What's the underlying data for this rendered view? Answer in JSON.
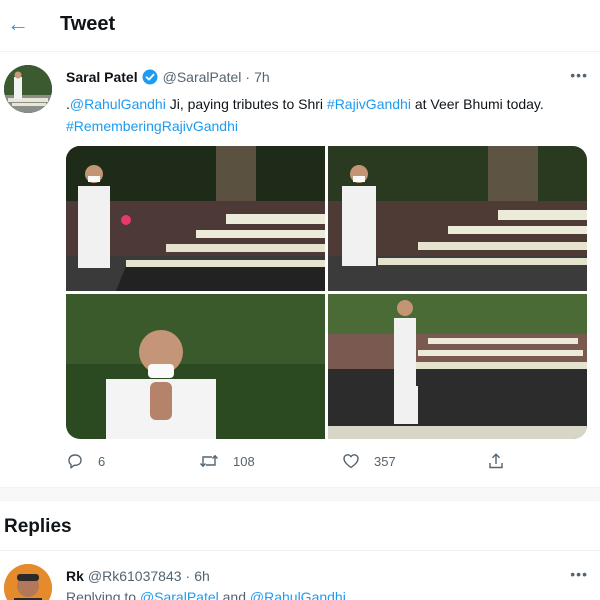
{
  "header": {
    "back_icon": "arrow-left-icon",
    "title": "Tweet"
  },
  "tweet": {
    "author_name": "Saral Patel",
    "verified": true,
    "handle": "@SaralPatel",
    "separator": "·",
    "time": "7h",
    "more": "•••",
    "text": {
      "prefix": ".",
      "mention": "@RahulGandhi",
      "middle1": " Ji, paying tributes to Shri ",
      "hashtag1": "#RajivGandhi",
      "middle2": " at Veer Bhumi today.",
      "hashtag2": "#RememberingRajivGandhi"
    },
    "media_count": 4,
    "actions": {
      "reply_count": "6",
      "retweet_count": "108",
      "like_count": "357",
      "share_icon": "share-icon"
    }
  },
  "replies": {
    "title": "Replies",
    "items": [
      {
        "name": "Rk",
        "handle": "@Rk61037843",
        "separator": "·",
        "time": "6h",
        "more": "•••",
        "replying_prefix": "Replying to ",
        "replying_to_1": "@SaralPatel",
        "replying_and": " and ",
        "replying_to_2": "@RahulGandhi"
      }
    ]
  },
  "colors": {
    "accent": "#1d9bf0",
    "text": "#0f1419",
    "muted": "#536471"
  }
}
